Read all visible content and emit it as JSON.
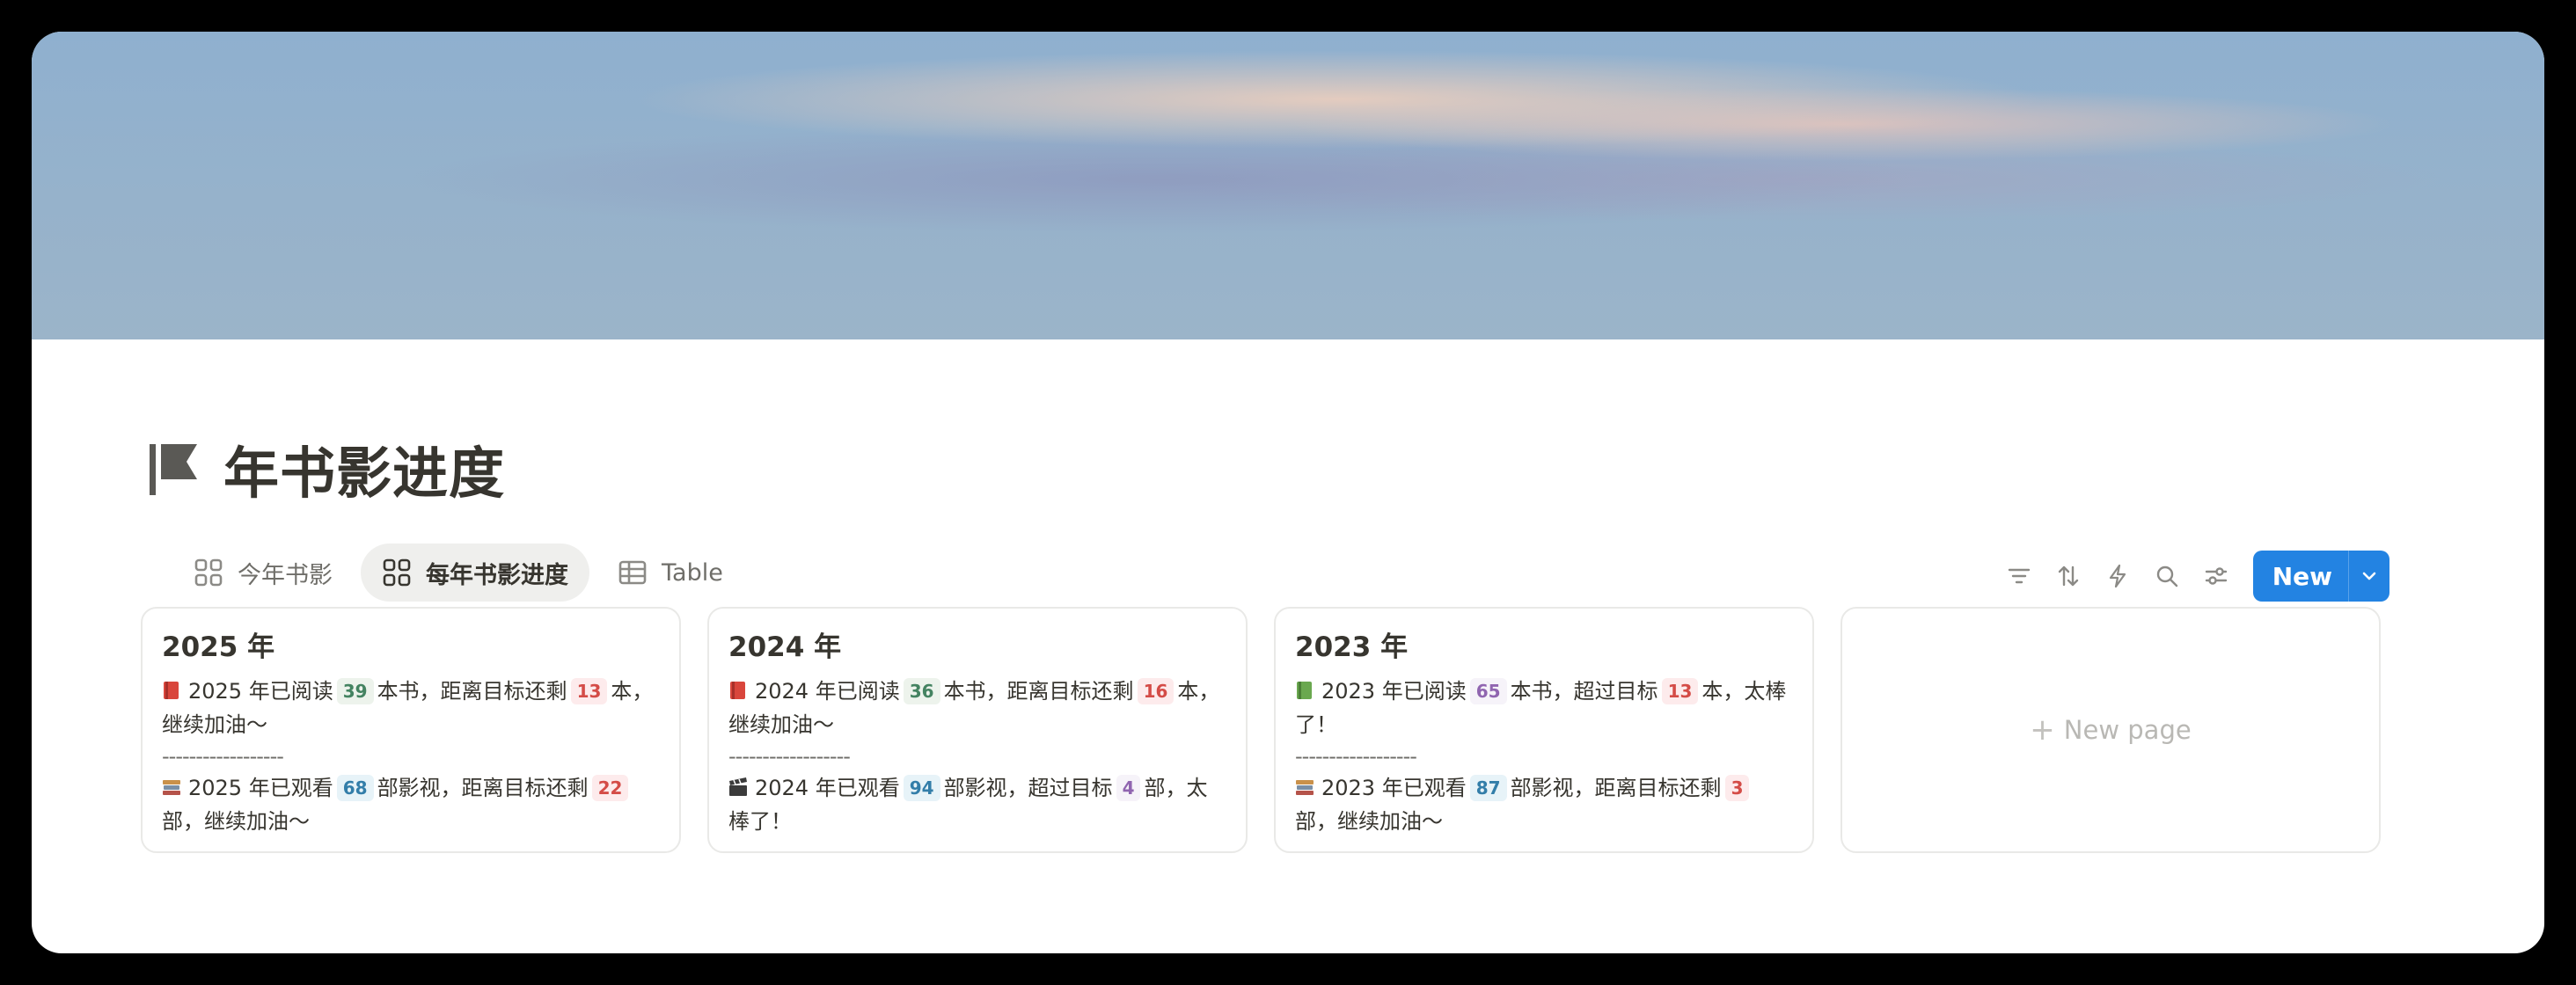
{
  "page": {
    "title": "年书影进度"
  },
  "tabs": [
    {
      "label": "今年书影",
      "icon": "gallery-icon",
      "active": false
    },
    {
      "label": "每年书影进度",
      "icon": "gallery-icon",
      "active": true
    },
    {
      "label": "Table",
      "icon": "table-icon",
      "active": false
    }
  ],
  "toolbar": {
    "new_label": "New",
    "accent": "#2383e2"
  },
  "cards": [
    {
      "title": "2025 年",
      "books_pre": "2025 年已阅读",
      "books_count": "39",
      "books_mid": "本书，距离目标还剩",
      "books_diff": "13",
      "books_post": "本，继续加油～",
      "divider": "------------------",
      "films_pre": "2025 年已观看",
      "films_count": "68",
      "films_mid": "部影视，距离目标还剩",
      "films_diff": "22",
      "films_post": "部，继续加油～"
    },
    {
      "title": "2024 年",
      "books_pre": "2024 年已阅读",
      "books_count": "36",
      "books_mid": "本书，距离目标还剩",
      "books_diff": "16",
      "books_post": "本，继续加油～",
      "divider": "------------------",
      "films_pre": "2024 年已观看",
      "films_count": "94",
      "films_mid": "部影视，超过目标",
      "films_diff": "4",
      "films_post": "部，太棒了！"
    },
    {
      "title": "2023 年",
      "books_pre": "2023 年已阅读",
      "books_count": "65",
      "books_mid": "本书，超过目标",
      "books_diff": "13",
      "books_post": "本，太棒了！",
      "divider": "------------------",
      "films_pre": "2023 年已观看",
      "films_count": "87",
      "films_mid": "部影视，距离目标还剩",
      "films_diff": "3",
      "films_post": "部，继续加油～"
    }
  ],
  "new_page": {
    "label": "New page"
  }
}
